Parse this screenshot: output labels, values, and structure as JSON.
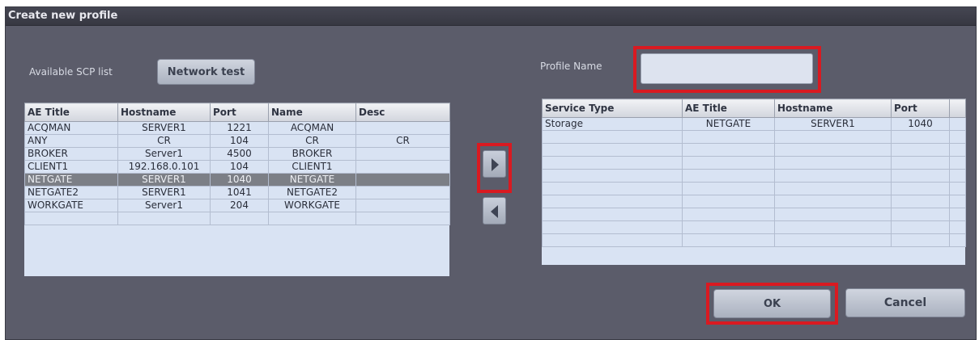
{
  "dialog": {
    "title": "Create new profile",
    "available_label": "Available SCP list",
    "network_test_label": "Network test",
    "profile_name_label": "Profile Name",
    "profile_name_value": "",
    "ok_label": "OK",
    "cancel_label": "Cancel"
  },
  "scp_table": {
    "columns": [
      "AE Title",
      "Hostname",
      "Port",
      "Name",
      "Desc"
    ],
    "rows": [
      [
        "ACQMAN",
        "SERVER1",
        "1221",
        "ACQMAN",
        ""
      ],
      [
        "ANY",
        "CR",
        "104",
        "CR",
        "CR"
      ],
      [
        "BROKER",
        "Server1",
        "4500",
        "BROKER",
        ""
      ],
      [
        "CLIENT1",
        "192.168.0.101",
        "104",
        "CLIENT1",
        ""
      ],
      [
        "NETGATE",
        "SERVER1",
        "1040",
        "NETGATE",
        ""
      ],
      [
        "NETGATE2",
        "SERVER1",
        "1041",
        "NETGATE2",
        ""
      ],
      [
        "WORKGATE",
        "Server1",
        "204",
        "WORKGATE",
        ""
      ]
    ],
    "selected_row": "NETGATE"
  },
  "profile_table": {
    "columns": [
      "Service Type",
      "AE Title",
      "Hostname",
      "Port"
    ],
    "rows": [
      [
        "Storage",
        "NETGATE",
        "SERVER1",
        "1040"
      ]
    ]
  },
  "icons": {
    "add": "arrow-right-icon",
    "remove": "arrow-left-icon"
  },
  "colors": {
    "highlight": "#d91a21",
    "dialog_bg": "#5b5c6a",
    "selected_row": "#7c7f86"
  }
}
